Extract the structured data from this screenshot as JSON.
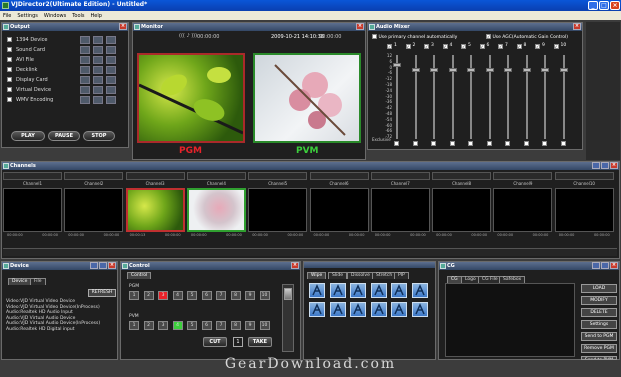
{
  "app": {
    "title": "VJDirector2(Ultimate Edition) - Untitled*"
  },
  "menu": [
    "File",
    "Settings",
    "Windows",
    "Tools",
    "Help"
  ],
  "output": {
    "title": "Output",
    "rows": [
      "1394 Device",
      "Sound Card",
      "AVI File",
      "Decklink",
      "Display Card",
      "Virtual Device",
      "WMV Encoding"
    ],
    "play": "PLAY",
    "pause": "PAUSE",
    "stop": "STOP"
  },
  "monitor": {
    "title": "Monitor",
    "timecode_left": "00:00:00",
    "timecode_right": "00:00:00",
    "datetime": "2009-10-21 14:10:38",
    "pgm": "PGM",
    "pvm": "PVM"
  },
  "audio": {
    "title": "Audio Mixer",
    "opt1": "Use primary channel automatically",
    "opt2": "Use AGC(Automatic Gain Control)",
    "channels": [
      "1",
      "2",
      "3",
      "4",
      "5",
      "6",
      "7",
      "8",
      "9",
      "10"
    ],
    "scale": [
      "12",
      "6",
      "0",
      "-6",
      "-12",
      "-18",
      "-24",
      "-30",
      "-36",
      "-42",
      "-48",
      "-54",
      "-60",
      "-66",
      "-72",
      "Exclusive"
    ],
    "levels": [
      0.9,
      0.85,
      0.85,
      0.85,
      0.85,
      0.85,
      0.85,
      0.85,
      0.85,
      0.85
    ]
  },
  "channels": {
    "title": "Channels",
    "names": [
      "Channel1",
      "Channel2",
      "Channel3",
      "Channel4",
      "Channel5",
      "Channel6",
      "Channel7",
      "Channel8",
      "Channel9",
      "Channel10"
    ],
    "time": "00:00:00",
    "time_active": "00:00:13"
  },
  "device": {
    "title": "Device",
    "tabs": [
      "Device",
      "File"
    ],
    "refresh": "REFRESH",
    "items": [
      "Video:VJD Virtual Video Device",
      "Video:VJD Virtual Video Device(InProcess)",
      "Audio:Realtek HD Audio Input",
      "Audio:VJD Virtual Audio Device",
      "Audio:VJD Virtual Audio Device(InProcess)",
      "Audio:Realtek HD Digital input"
    ]
  },
  "control": {
    "title": "Control",
    "tab": "Control",
    "pgm": "PGM",
    "pvm": "PVM",
    "numbers": [
      "1",
      "2",
      "3",
      "4",
      "5",
      "6",
      "7",
      "8",
      "9",
      "10"
    ],
    "cut": "CUT",
    "mid": "1",
    "take": "TAKE"
  },
  "wipe": {
    "tabs": [
      "Wipe",
      "Slide",
      "Dissolve",
      "Stretch",
      "PIP"
    ]
  },
  "cg": {
    "title": "CG",
    "tabs": [
      "CG",
      "Logo",
      "CG File",
      "Safebox"
    ],
    "buttons": [
      "LOAD",
      "MODIFY",
      "DELETE",
      "Settings",
      "Send to PGM",
      "Remove PGM",
      "Send to PVM"
    ]
  },
  "colors": {
    "pgm": "#e8222a",
    "pvm": "#3ccf3c",
    "panel_title": "#344866"
  },
  "watermark": "GearDownload.com"
}
